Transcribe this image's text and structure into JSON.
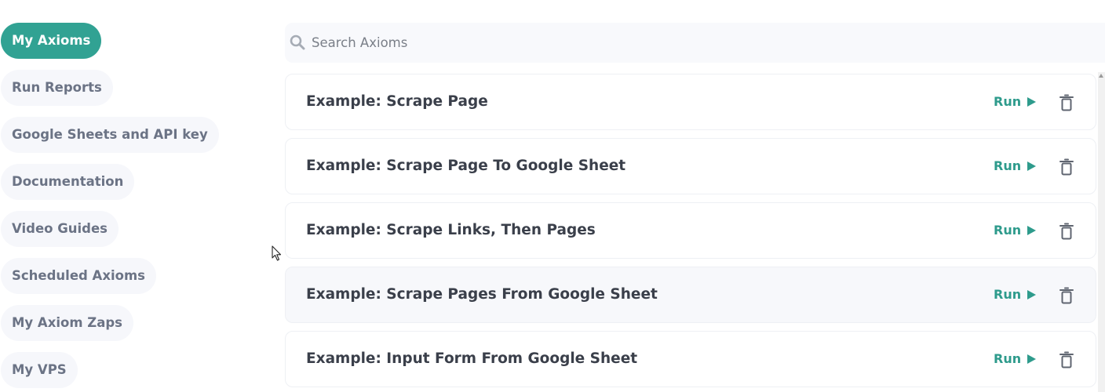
{
  "sidebar": {
    "items": [
      {
        "label": "My Axioms",
        "active": true
      },
      {
        "label": "Run Reports"
      },
      {
        "label": "Google Sheets and API key"
      },
      {
        "label": "Documentation"
      },
      {
        "label": "Video Guides"
      },
      {
        "label": "Scheduled Axioms"
      },
      {
        "label": "My Axiom Zaps"
      },
      {
        "label": "My VPS"
      }
    ]
  },
  "search": {
    "placeholder": "Search Axioms",
    "value": "",
    "icon": "search-icon"
  },
  "axioms": [
    {
      "title": "Example: Scrape Page",
      "run_label": "Run"
    },
    {
      "title": "Example: Scrape Page To Google Sheet",
      "run_label": "Run"
    },
    {
      "title": "Example: Scrape Links, Then Pages",
      "run_label": "Run"
    },
    {
      "title": "Example: Scrape Pages From Google Sheet",
      "run_label": "Run",
      "hovered": true
    },
    {
      "title": "Example: Input Form From Google Sheet",
      "run_label": "Run"
    }
  ],
  "colors": {
    "accent": "#31a293",
    "run_text": "#2e9b8c",
    "nav_bg": "#f6f7fb",
    "nav_text": "#6b7385"
  },
  "icons": {
    "run": "play-icon",
    "delete": "trash-icon"
  }
}
